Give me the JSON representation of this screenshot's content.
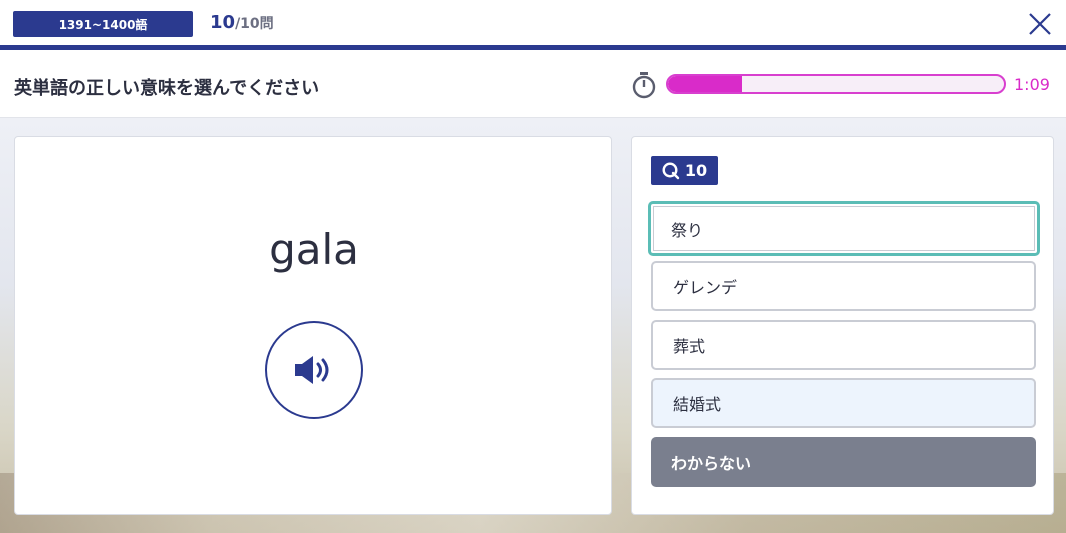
{
  "header": {
    "range_label": "1391~1400語",
    "question_current": "10",
    "question_total": "/10問"
  },
  "question": {
    "instruction": "英単語の正しい意味を選んでください",
    "timer_text": "1:09",
    "timer_progress": 0.22
  },
  "word_card": {
    "word": "gala",
    "audio_icon": "speaker-icon"
  },
  "choices_panel": {
    "question_number": "10",
    "choices": [
      {
        "label": "祭り",
        "state": "selected"
      },
      {
        "label": "ゲレンデ",
        "state": "default"
      },
      {
        "label": "葬式",
        "state": "default"
      },
      {
        "label": "結婚式",
        "state": "hover"
      }
    ],
    "dont_know_label": "わからない"
  },
  "colors": {
    "primary": "#2b3a8f",
    "timer": "#d92bc9",
    "selected_border": "#5bbdb6",
    "dont_know_bg": "#7a7f8e"
  }
}
